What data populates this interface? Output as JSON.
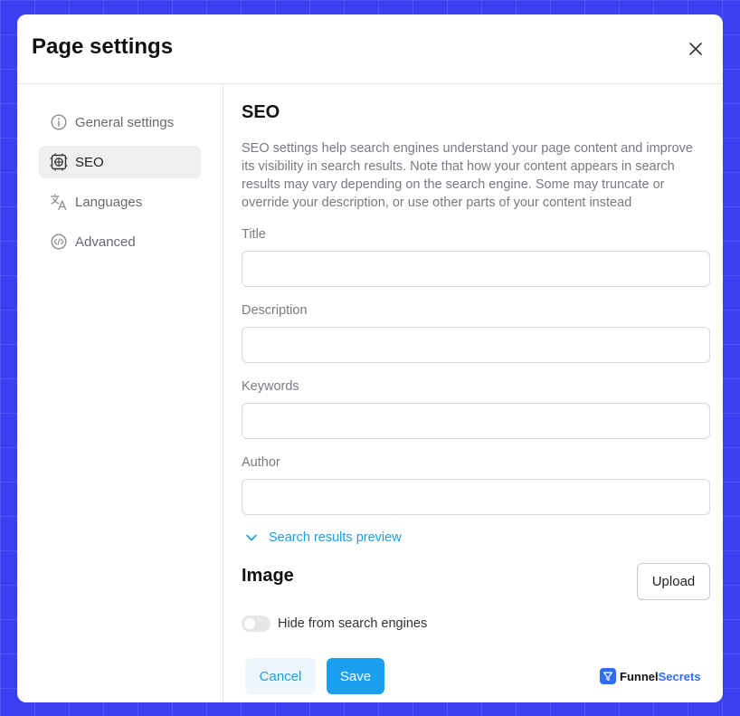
{
  "modal": {
    "title": "Page settings"
  },
  "sidebar": {
    "items": [
      {
        "label": "General settings",
        "icon": "info-icon"
      },
      {
        "label": "SEO",
        "icon": "seo-icon",
        "active": true
      },
      {
        "label": "Languages",
        "icon": "translate-icon"
      },
      {
        "label": "Advanced",
        "icon": "code-icon"
      }
    ]
  },
  "seo": {
    "title": "SEO",
    "description": "SEO settings help search engines understand your page content and improve its visibility in search results. Note that how your content appears in search results may vary depending on the search engine. Some may truncate or override your description, or use other parts of your content instead",
    "fields": {
      "title_label": "Title",
      "title_value": "",
      "description_label": "Description",
      "description_value": "",
      "keywords_label": "Keywords",
      "keywords_value": "",
      "author_label": "Author",
      "author_value": ""
    },
    "preview_label": "Search results preview",
    "image_title": "Image",
    "upload_label": "Upload",
    "hide_label": "Hide from search engines",
    "hide_enabled": false
  },
  "footer": {
    "cancel_label": "Cancel",
    "save_label": "Save",
    "brand_part1": "Funnel",
    "brand_part2": "Secrets"
  },
  "colors": {
    "background": "#3b3ff2",
    "accent": "#1aa0ef",
    "link": "#1a9fe0",
    "brand": "#2f6df6"
  }
}
